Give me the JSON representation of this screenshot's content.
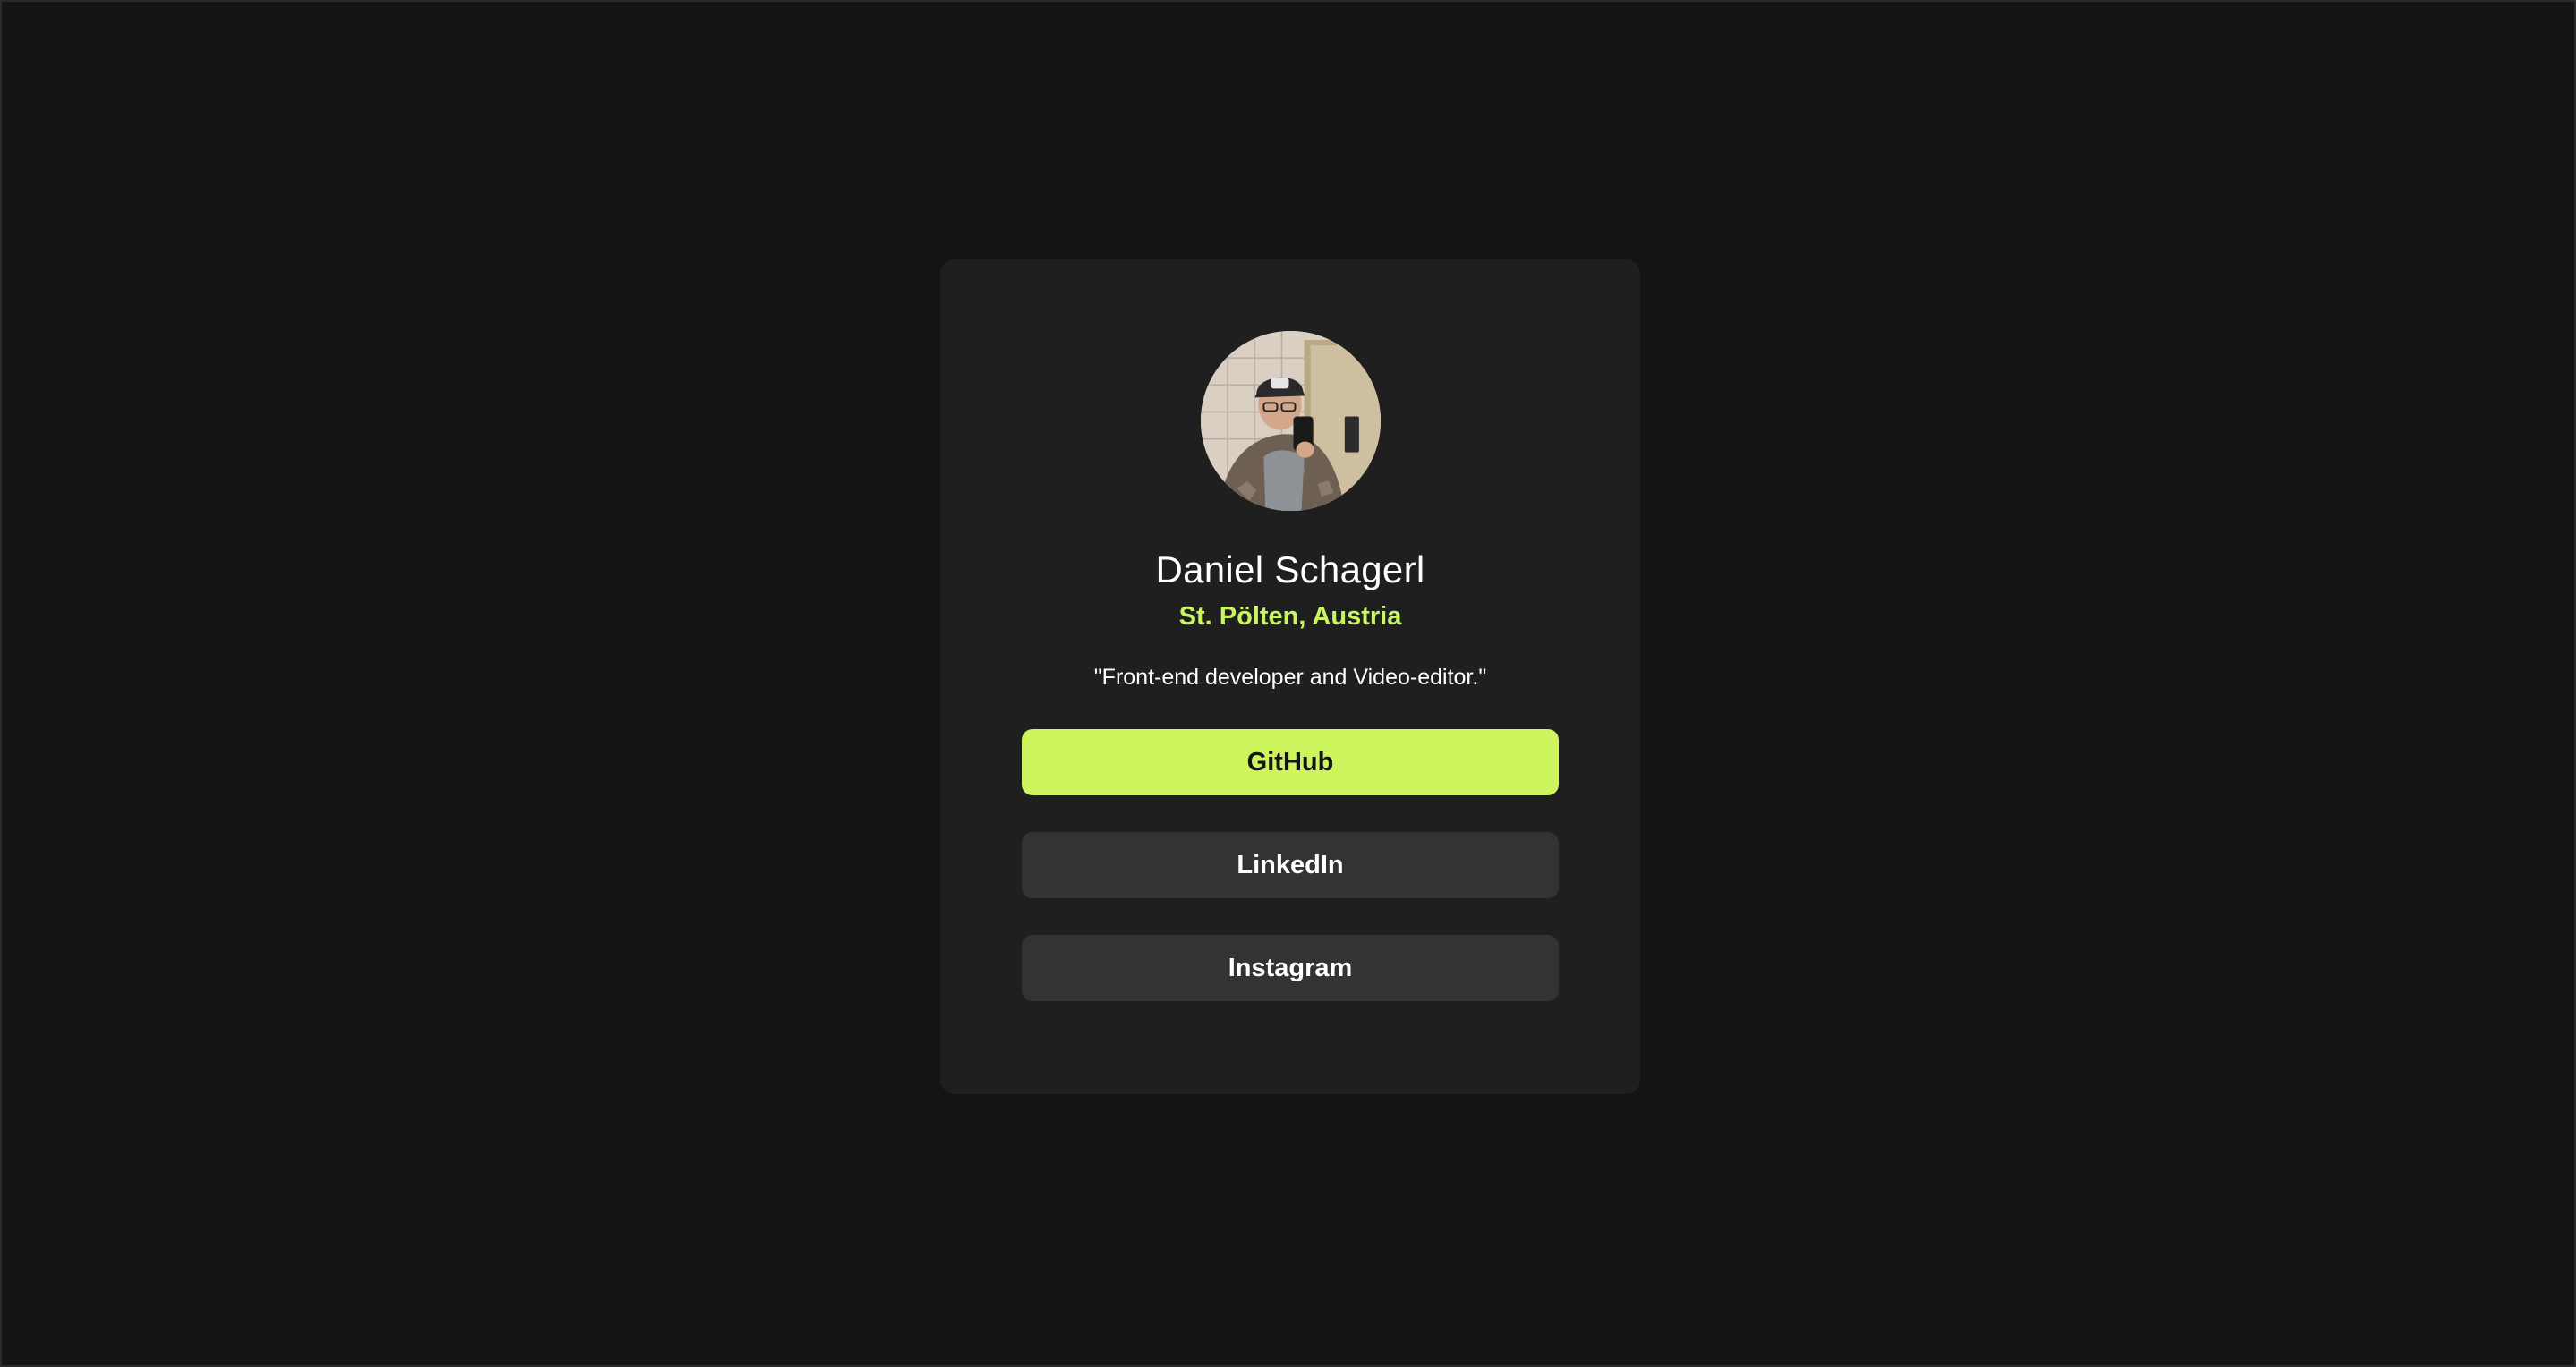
{
  "profile": {
    "name": "Daniel Schagerl",
    "location": "St. Pölten, Austria",
    "bio": "\"Front-end developer and Video-editor.\""
  },
  "links": {
    "github": "GitHub",
    "linkedin": "LinkedIn",
    "instagram": "Instagram"
  },
  "colors": {
    "page_background": "#141414",
    "card_background": "#1f1f1f",
    "accent": "#cef55d",
    "button_background": "#333333",
    "text": "#ffffff"
  },
  "icons": {
    "avatar": "profile-photo"
  }
}
